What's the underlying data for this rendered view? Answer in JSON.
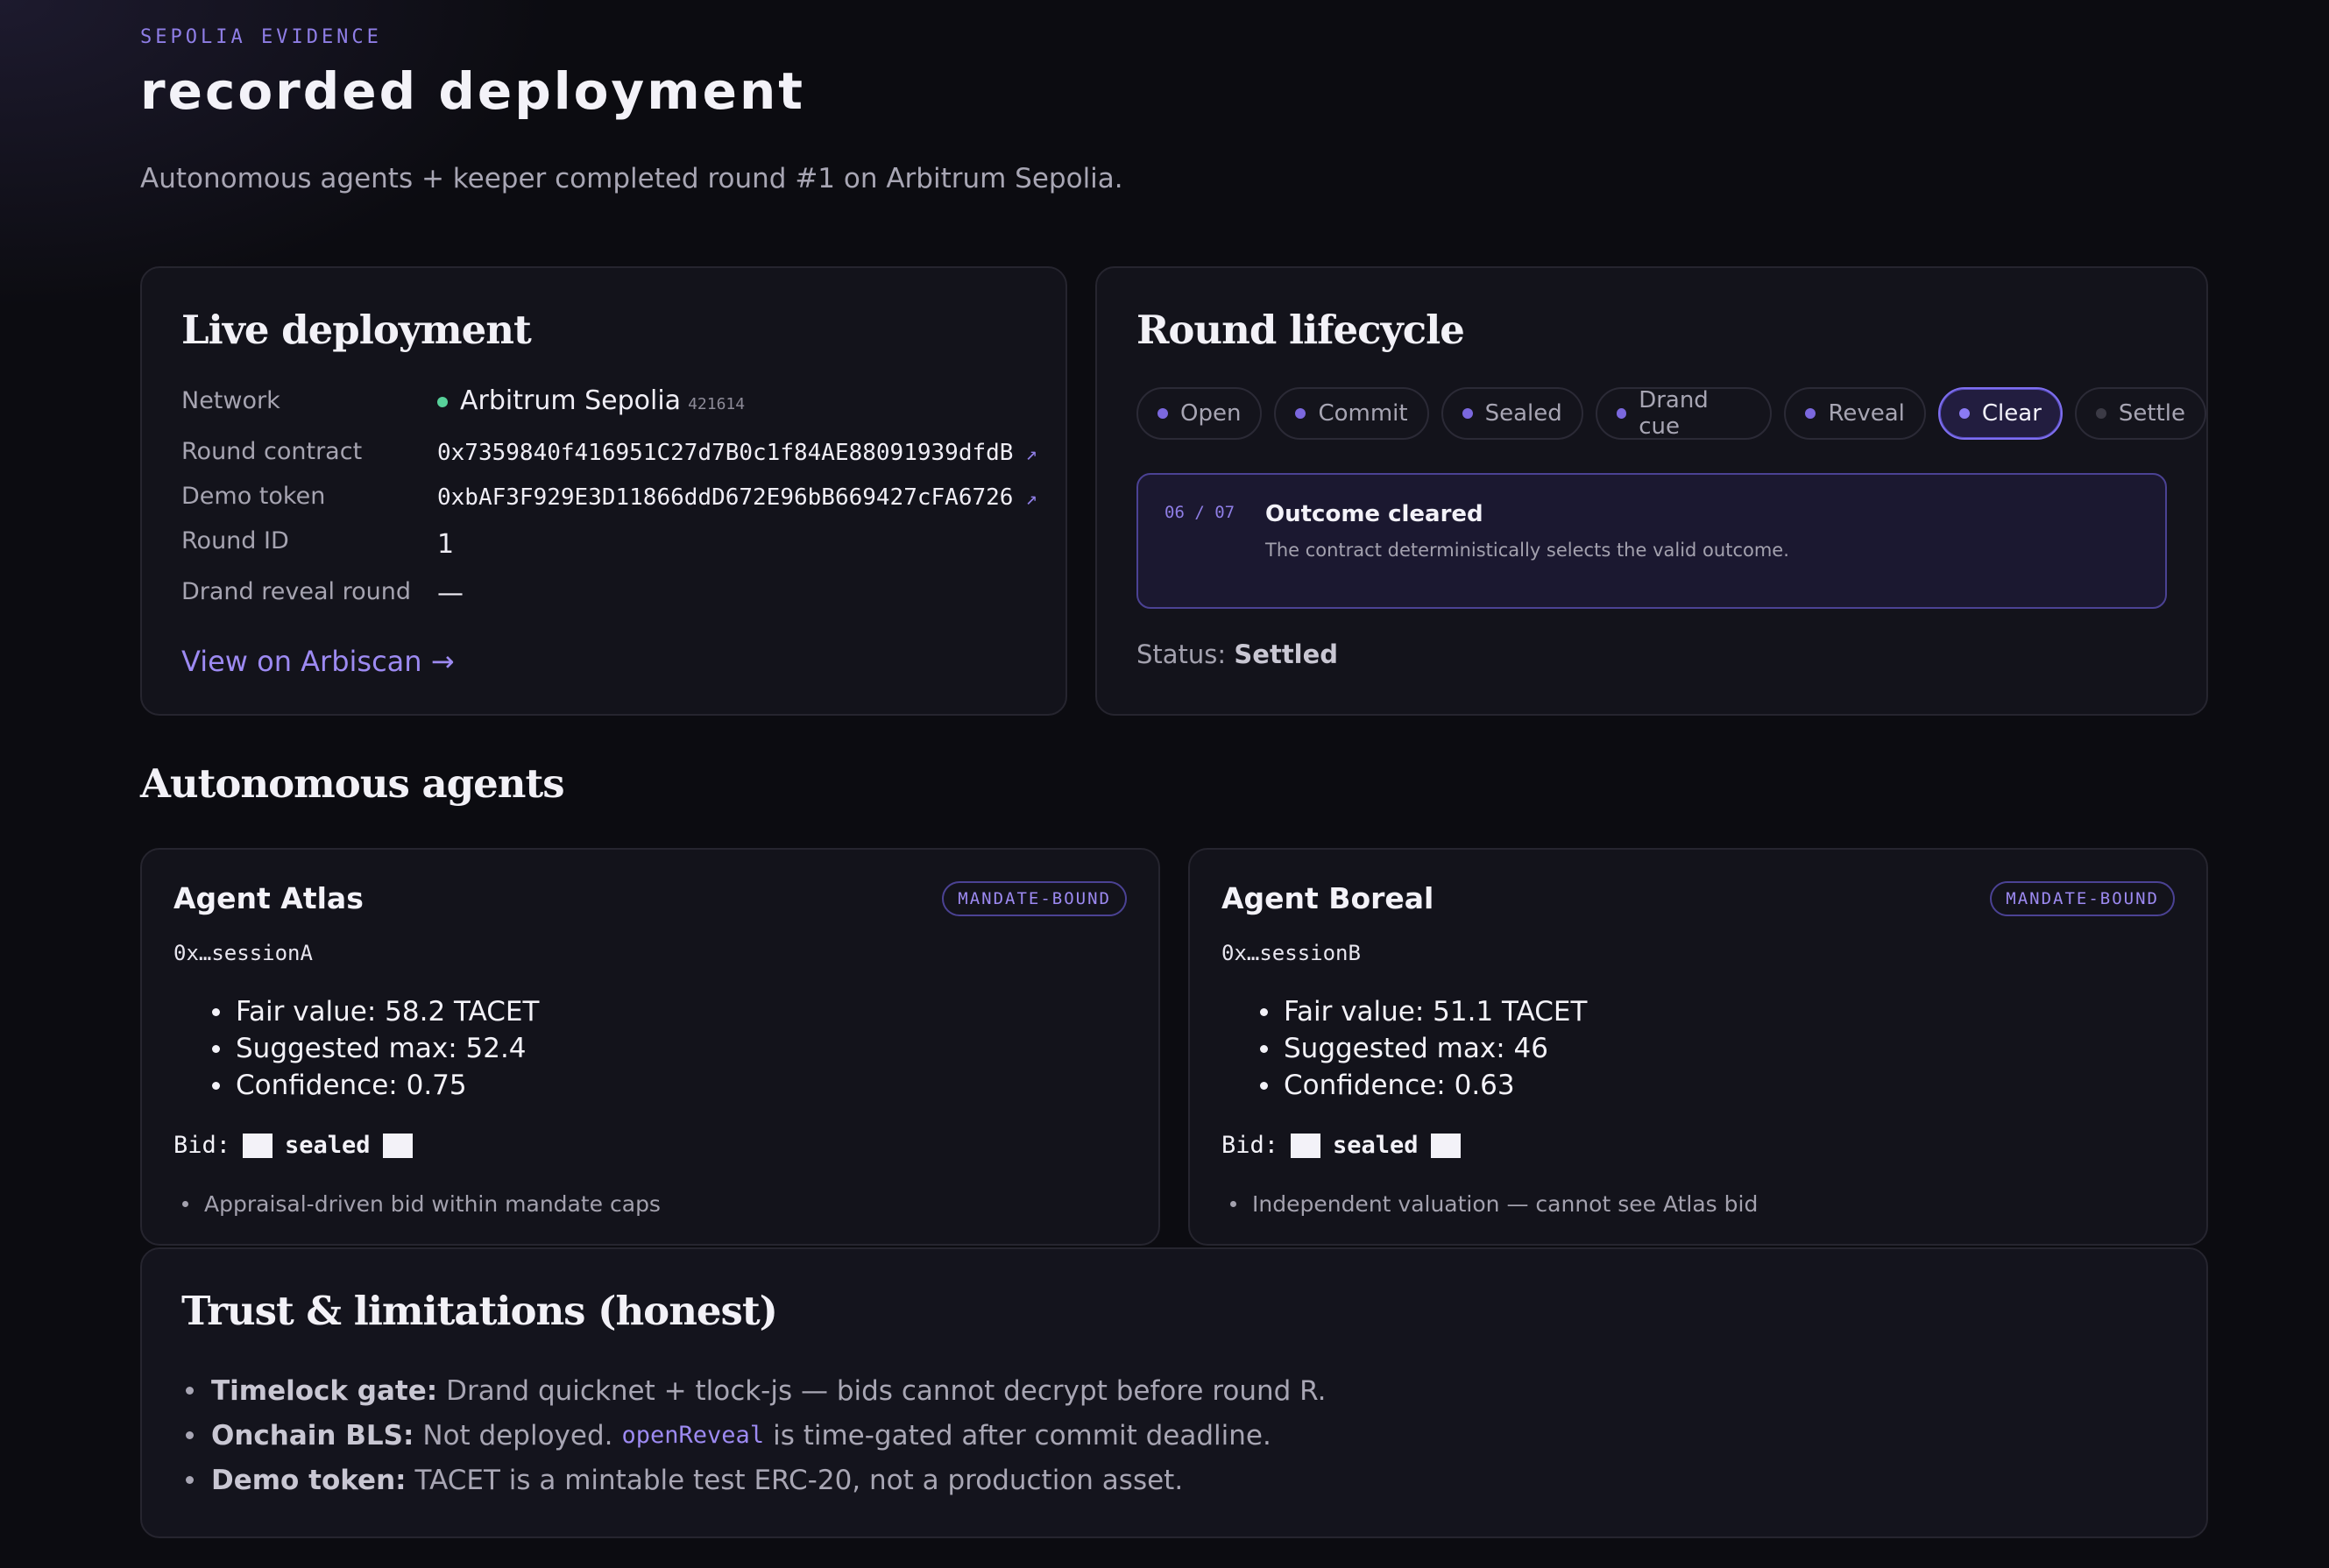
{
  "header": {
    "eyebrow": "SEPOLIA EVIDENCE",
    "title": "recorded deployment",
    "subtitle": "Autonomous agents + keeper completed round #1 on Arbitrum Sepolia."
  },
  "deployment": {
    "title": "Live deployment",
    "network_label": "Network",
    "network_value": "Arbitrum Sepolia",
    "chain_id": "421614",
    "round_contract_label": "Round contract",
    "round_contract_value": "0x7359840f416951C27d7B0c1f84AE88091939dfdB",
    "demo_token_label": "Demo token",
    "demo_token_value": "0xbAF3F929E3D11866ddD672E96bB669427cFA6726",
    "round_id_label": "Round ID",
    "round_id_value": "1",
    "drand_label": "Drand reveal round",
    "drand_value": "—",
    "external_link_icon": "↗",
    "arbiscan_link": "View on Arbiscan →",
    "status_color": "#57d19a"
  },
  "lifecycle": {
    "title": "Round lifecycle",
    "steps": [
      {
        "label": "Open",
        "state": "done"
      },
      {
        "label": "Commit",
        "state": "done"
      },
      {
        "label": "Sealed",
        "state": "done"
      },
      {
        "label": "Drand cue",
        "state": "done"
      },
      {
        "label": "Reveal",
        "state": "done"
      },
      {
        "label": "Clear",
        "state": "active"
      },
      {
        "label": "Settle",
        "state": "pending"
      }
    ],
    "outcome_step": "06 / 07",
    "outcome_title": "Outcome cleared",
    "outcome_desc": "The contract deterministically selects the valid outcome.",
    "status_label": "Status:",
    "status_value": "Settled",
    "accent_color": "#7f6ff0"
  },
  "agents": {
    "title": "Autonomous agents",
    "list": [
      {
        "name": "Agent Atlas",
        "badge": "MANDATE-BOUND",
        "session": "0x…sessionA",
        "fair_value": "Fair value: 58.2 TACET",
        "suggested_max": "Suggested max: 52.4",
        "confidence": "Confidence: 0.75",
        "bid_label": "Bid:",
        "bid_value": "sealed",
        "note": "Appraisal-driven bid within mandate caps"
      },
      {
        "name": "Agent Boreal",
        "badge": "MANDATE-BOUND",
        "session": "0x…sessionB",
        "fair_value": "Fair value: 51.1 TACET",
        "suggested_max": "Suggested max: 46",
        "confidence": "Confidence: 0.63",
        "bid_label": "Bid:",
        "bid_value": "sealed",
        "note": "Independent valuation — cannot see Atlas bid"
      }
    ]
  },
  "trust": {
    "title": "Trust & limitations (honest)",
    "items": [
      {
        "term": "Timelock gate:",
        "text": "Drand quicknet + tlock-js — bids cannot decrypt before round R."
      },
      {
        "term": "Onchain BLS:",
        "text_before": "Not deployed.",
        "code": "openReveal",
        "text_after": "is time-gated after commit deadline."
      },
      {
        "term": "Demo token:",
        "text": "TACET is a mintable test ERC-20, not a production asset."
      }
    ]
  }
}
